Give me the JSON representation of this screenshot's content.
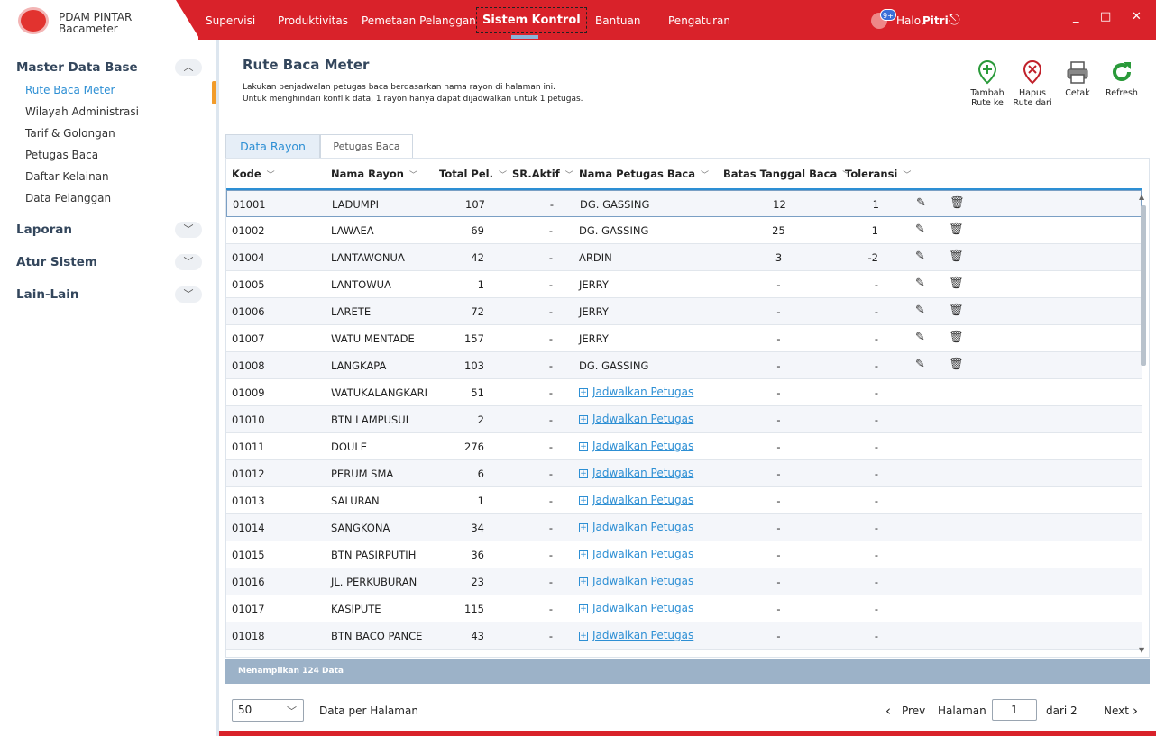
{
  "app": {
    "name_line1": "PDAM PINTAR",
    "name_line2": "Bacameter",
    "logo_icon": "pdam-logo-icon"
  },
  "nav": [
    {
      "label": "Supervisi"
    },
    {
      "label": "Produktivitas"
    },
    {
      "label": "Pemetaan Pelanggan"
    },
    {
      "label": "Sistem Kontrol",
      "active": true
    },
    {
      "label": "Bantuan"
    },
    {
      "label": "Pengaturan"
    }
  ],
  "user": {
    "greeting": "Halo,",
    "name": "Pitri",
    "notif_badge": "9+"
  },
  "window": {
    "minimize": "_",
    "maximize": "□",
    "close": "✕"
  },
  "sidebar": {
    "sections": [
      {
        "label": "Master Data Base",
        "expanded": true,
        "toggle": "︿"
      },
      {
        "label": "Laporan",
        "toggle": "﹀"
      },
      {
        "label": "Atur Sistem",
        "toggle": "﹀"
      },
      {
        "label": "Lain-Lain",
        "toggle": "﹀"
      }
    ],
    "items": [
      {
        "label": "Rute Baca Meter",
        "active": true
      },
      {
        "label": "Wilayah Administrasi"
      },
      {
        "label": "Tarif & Golongan"
      },
      {
        "label": "Petugas Baca"
      },
      {
        "label": "Daftar Kelainan"
      },
      {
        "label": "Data Pelanggan"
      }
    ]
  },
  "page": {
    "title": "Rute Baca Meter",
    "desc1": "Lakukan penjadwalan petugas baca berdasarkan nama rayon di halaman ini.",
    "desc2": "Untuk menghindari konflik data, 1 rayon hanya dapat dijadwalkan untuk 1 petugas."
  },
  "toolbar": {
    "add": {
      "line1": "Tambah",
      "line2": "Rute ke",
      "icon": "map-pin-plus-icon"
    },
    "remove": {
      "line1": "Hapus",
      "line2": "Rute dari",
      "icon": "map-pin-minus-icon"
    },
    "print": {
      "label": "Cetak",
      "icon": "printer-icon"
    },
    "refresh": {
      "label": "Refresh",
      "icon": "refresh-icon"
    }
  },
  "tabs": [
    {
      "label": "Data Rayon",
      "active": true
    },
    {
      "label": "Petugas Baca"
    }
  ],
  "table": {
    "columns": [
      "Kode",
      "Nama Rayon",
      "Total Pel.",
      "SR.Aktif",
      "Nama Petugas Baca",
      "Batas Tanggal Baca",
      "Toleransi"
    ],
    "schedule_label": "Jadwalkan Petugas",
    "rows": [
      {
        "kode": "01001",
        "nama": "LADUMPI",
        "total": "107",
        "aktif": "-",
        "petugas": "DG. GASSING",
        "batas": "12",
        "tol": "1"
      },
      {
        "kode": "01002",
        "nama": "LAWAEA",
        "total": "69",
        "aktif": "-",
        "petugas": "DG. GASSING",
        "batas": "25",
        "tol": "1"
      },
      {
        "kode": "01004",
        "nama": "LANTAWONUA",
        "total": "42",
        "aktif": "-",
        "petugas": "ARDIN",
        "batas": "3",
        "tol": "-2"
      },
      {
        "kode": "01005",
        "nama": "LANTOWUA",
        "total": "1",
        "aktif": "-",
        "petugas": "JERRY",
        "batas": "-",
        "tol": "-"
      },
      {
        "kode": "01006",
        "nama": "LARETE",
        "total": "72",
        "aktif": "-",
        "petugas": "JERRY",
        "batas": "-",
        "tol": "-"
      },
      {
        "kode": "01007",
        "nama": "WATU MENTADE",
        "total": "157",
        "aktif": "-",
        "petugas": "JERRY",
        "batas": "-",
        "tol": "-"
      },
      {
        "kode": "01008",
        "nama": "LANGKAPA",
        "total": "103",
        "aktif": "-",
        "petugas": "DG. GASSING",
        "batas": "-",
        "tol": "-"
      },
      {
        "kode": "01009",
        "nama": "WATUKALANGKARI",
        "total": "51",
        "aktif": "-",
        "petugas": "",
        "batas": "-",
        "tol": "-"
      },
      {
        "kode": "01010",
        "nama": "BTN LAMPUSUI",
        "total": "2",
        "aktif": "-",
        "petugas": "",
        "batas": "-",
        "tol": "-"
      },
      {
        "kode": "01011",
        "nama": "DOULE",
        "total": "276",
        "aktif": "-",
        "petugas": "",
        "batas": "-",
        "tol": "-"
      },
      {
        "kode": "01012",
        "nama": "PERUM SMA",
        "total": "6",
        "aktif": "-",
        "petugas": "",
        "batas": "-",
        "tol": "-"
      },
      {
        "kode": "01013",
        "nama": "SALURAN",
        "total": "1",
        "aktif": "-",
        "petugas": "",
        "batas": "-",
        "tol": "-"
      },
      {
        "kode": "01014",
        "nama": "SANGKONA",
        "total": "34",
        "aktif": "-",
        "petugas": "",
        "batas": "-",
        "tol": "-"
      },
      {
        "kode": "01015",
        "nama": "BTN PASIRPUTIH",
        "total": "36",
        "aktif": "-",
        "petugas": "",
        "batas": "-",
        "tol": "-"
      },
      {
        "kode": "01016",
        "nama": "JL. PERKUBURAN",
        "total": "23",
        "aktif": "-",
        "petugas": "",
        "batas": "-",
        "tol": "-"
      },
      {
        "kode": "01017",
        "nama": "KASIPUTE",
        "total": "115",
        "aktif": "-",
        "petugas": "",
        "batas": "-",
        "tol": "-"
      },
      {
        "kode": "01018",
        "nama": "BTN BACO PANCE",
        "total": "43",
        "aktif": "-",
        "petugas": "",
        "batas": "-",
        "tol": "-"
      }
    ]
  },
  "footer": {
    "summary": "Menampilkan 124 Data"
  },
  "pagination": {
    "per_page": "50",
    "per_page_label": "Data per Halaman",
    "prev": "Prev",
    "page_label": "Halaman",
    "page": "1",
    "of": "dari 2",
    "next": "Next"
  },
  "colors": {
    "brand": "#d9222a",
    "accent": "#2d8fd4",
    "sidebar_indicator": "#f29c2b"
  }
}
